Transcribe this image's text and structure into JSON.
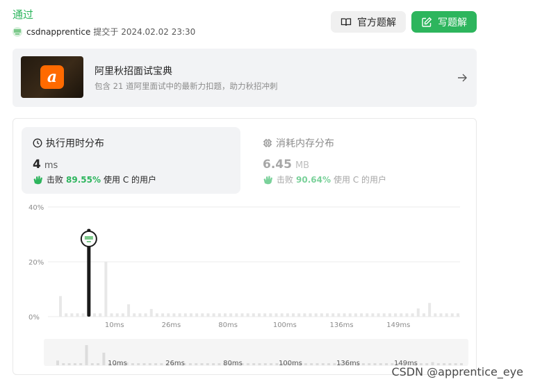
{
  "submission": {
    "status": "通过",
    "username": "csdnapprentice",
    "submitted_prefix": "提交于",
    "submitted_at": "2024.02.02 23:30"
  },
  "actions": {
    "official_solution": "官方题解",
    "write_solution": "写题解"
  },
  "banner": {
    "logo_text": "a",
    "title": "阿里秋招面试宝典",
    "subtitle": "包含 21 道阿里面试中的最新力扣题，助力秋招冲刺"
  },
  "runtime": {
    "heading": "执行用时分布",
    "value": "4",
    "unit": "ms",
    "beats_prefix": "击败",
    "beats_pct": "89.55%",
    "beats_suffix": "使用 C 的用户"
  },
  "memory": {
    "heading": "消耗内存分布",
    "value": "6.45",
    "unit": "MB",
    "beats_prefix": "击败",
    "beats_pct": "90.64%",
    "beats_suffix": "使用 C 的用户"
  },
  "chart_data": {
    "type": "bar",
    "ylim": [
      0,
      40
    ],
    "y_ticks": [
      "40%",
      "20%",
      "0%"
    ],
    "x_ticks": [
      "10ms",
      "26ms",
      "80ms",
      "100ms",
      "136ms",
      "149ms"
    ],
    "values": [
      7.5,
      1.2,
      1.2,
      1.2,
      1.2,
      32,
      1.2,
      1.2,
      20,
      1.2,
      1.2,
      1.2,
      4.5,
      1.2,
      1.2,
      1.2,
      2.8,
      1.2,
      1.2,
      1.2,
      1.2,
      1.2,
      1.2,
      1.2,
      1.2,
      1.2,
      1.2,
      1.2,
      1.2,
      1.2,
      1.2,
      1.2,
      1.2,
      1.2,
      1.2,
      1.2,
      1.2,
      1.2,
      1.2,
      1.2,
      1.2,
      1.2,
      1.2,
      1.2,
      1.2,
      1.2,
      1.2,
      1.2,
      1.2,
      1.2,
      1.2,
      1.2,
      1.2,
      1.2,
      1.2,
      1.2,
      1.2,
      1.2,
      1.2,
      1.2,
      1.2,
      1.2,
      1.2,
      3,
      1.2,
      5,
      1.2,
      1.2,
      1.2,
      1.2,
      1.2
    ],
    "highlight_index": 5,
    "colors": {
      "bar": "#e8e8e8",
      "highlight": "#1a1a1a",
      "grid": "#ebebeb",
      "label": "#8c8c8c"
    }
  },
  "watermark": "CSDN @apprentice_eye"
}
